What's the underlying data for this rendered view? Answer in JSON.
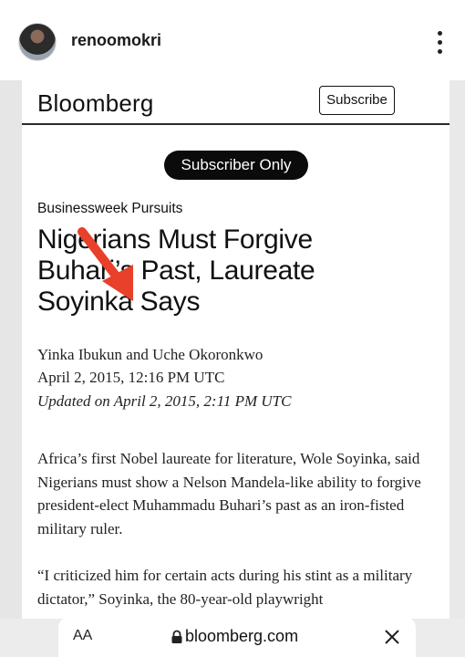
{
  "post": {
    "username": "renoomokri"
  },
  "article_page": {
    "brand": "Bloomberg",
    "subscribe_label": "Subscribe",
    "badge": "Subscriber Only",
    "section": "Businessweek Pursuits",
    "headline_lines": [
      "Nigerians Must Forgive",
      "Buhari’s Past, Laureate",
      "Soyinka Says"
    ],
    "byline": "Yinka Ibukun and Uche Okoronkwo",
    "date": "April 2, 2015, 12:16 PM UTC",
    "updated": "Updated on April 2, 2015, 2:11 PM UTC",
    "paragraph_1": "Africa’s first Nobel laureate for literature, Wole Soyinka, said Nigerians must show a Nelson Mandela-like ability to forgive president-elect Muhammadu Buhari’s past as an iron-fisted military ruler.",
    "paragraph_2": "“I criticized him for certain acts during his stint as a military dictator,” Soyinka, the 80-year-old playwright"
  },
  "browser": {
    "text_size_label": "AA",
    "url": "bloomberg.com"
  },
  "colors": {
    "arrow": "#e8402a",
    "badge_bg": "#0b0b0b"
  },
  "icons": {
    "more": "more-options-icon",
    "lock": "lock-icon",
    "close": "close-icon",
    "arrow": "red-arrow-annotation"
  }
}
